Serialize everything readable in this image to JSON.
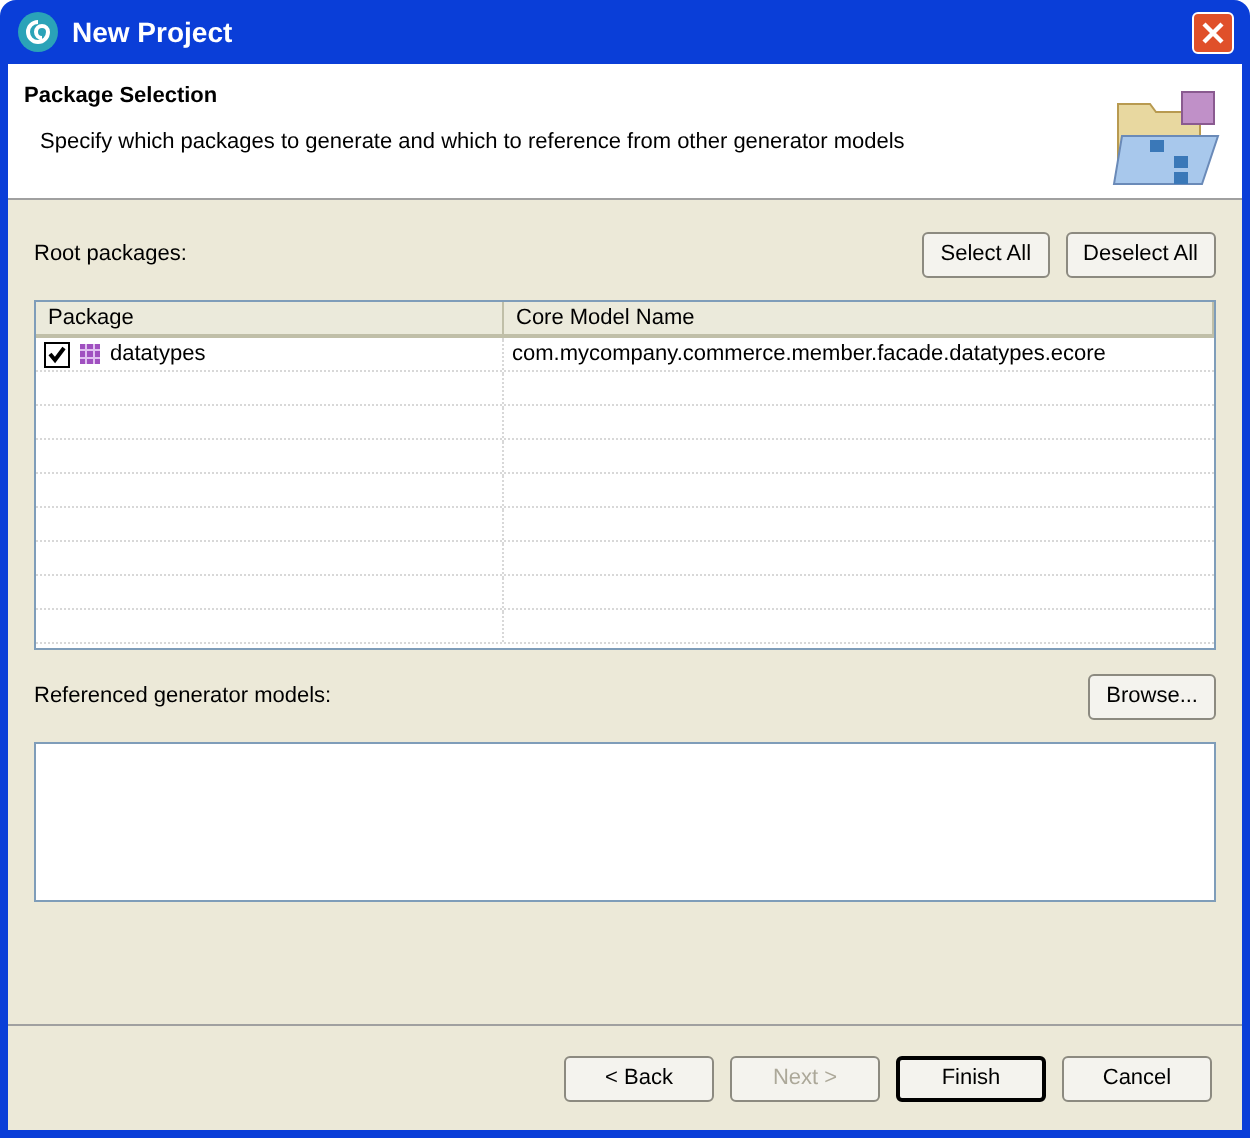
{
  "window": {
    "title": "New Project"
  },
  "header": {
    "title": "Package Selection",
    "description": "Specify which packages to generate and which to reference from other generator models"
  },
  "root_packages": {
    "label": "Root packages:",
    "buttons": [
      {
        "label": "Select All"
      },
      {
        "label": "Deselect All"
      }
    ]
  },
  "table": {
    "columns": [
      "Package",
      "Core Model Name"
    ],
    "rows": [
      {
        "package": "datatypes",
        "core_model_name": "com.mycompany.commerce.member.facade.datatypes.ecore",
        "checked": true
      }
    ]
  },
  "referenced": {
    "label": "Referenced generator models:",
    "button": "Browse..."
  },
  "buttons": [
    {
      "label": "< Back",
      "disabled": false,
      "default": false
    },
    {
      "label": "Next >",
      "disabled": true,
      "default": false
    },
    {
      "label": "Finish",
      "disabled": false,
      "default": true
    },
    {
      "label": "Cancel",
      "disabled": false,
      "default": false
    }
  ]
}
